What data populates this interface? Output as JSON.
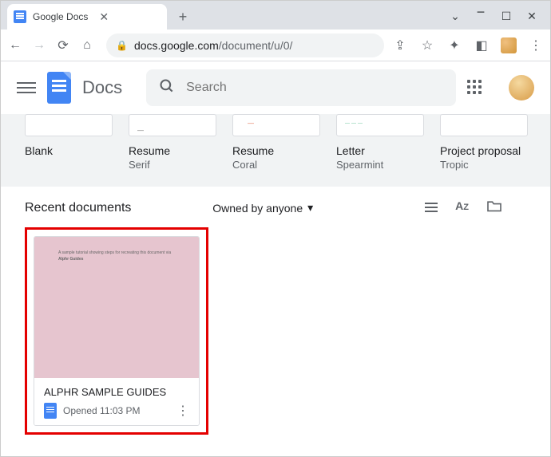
{
  "browser": {
    "tab_title": "Google Docs",
    "url_host": "docs.google.com",
    "url_path": "/document/u/0/"
  },
  "docs": {
    "app_name": "Docs",
    "search_placeholder": "Search"
  },
  "templates": [
    {
      "name": "Blank",
      "subtitle": ""
    },
    {
      "name": "Resume",
      "subtitle": "Serif"
    },
    {
      "name": "Resume",
      "subtitle": "Coral"
    },
    {
      "name": "Letter",
      "subtitle": "Spearmint"
    },
    {
      "name": "Project proposal",
      "subtitle": "Tropic"
    }
  ],
  "recent": {
    "heading": "Recent documents",
    "filter_label": "Owned by anyone",
    "sort_label": "AZ"
  },
  "documents": [
    {
      "title": "ALPHR SAMPLE GUIDES",
      "meta": "Opened 11:03 PM",
      "thumb_snippet_line1": "A sample tutorial showing steps for recreating this document via",
      "thumb_snippet_line2": "Alphr Guides"
    }
  ]
}
